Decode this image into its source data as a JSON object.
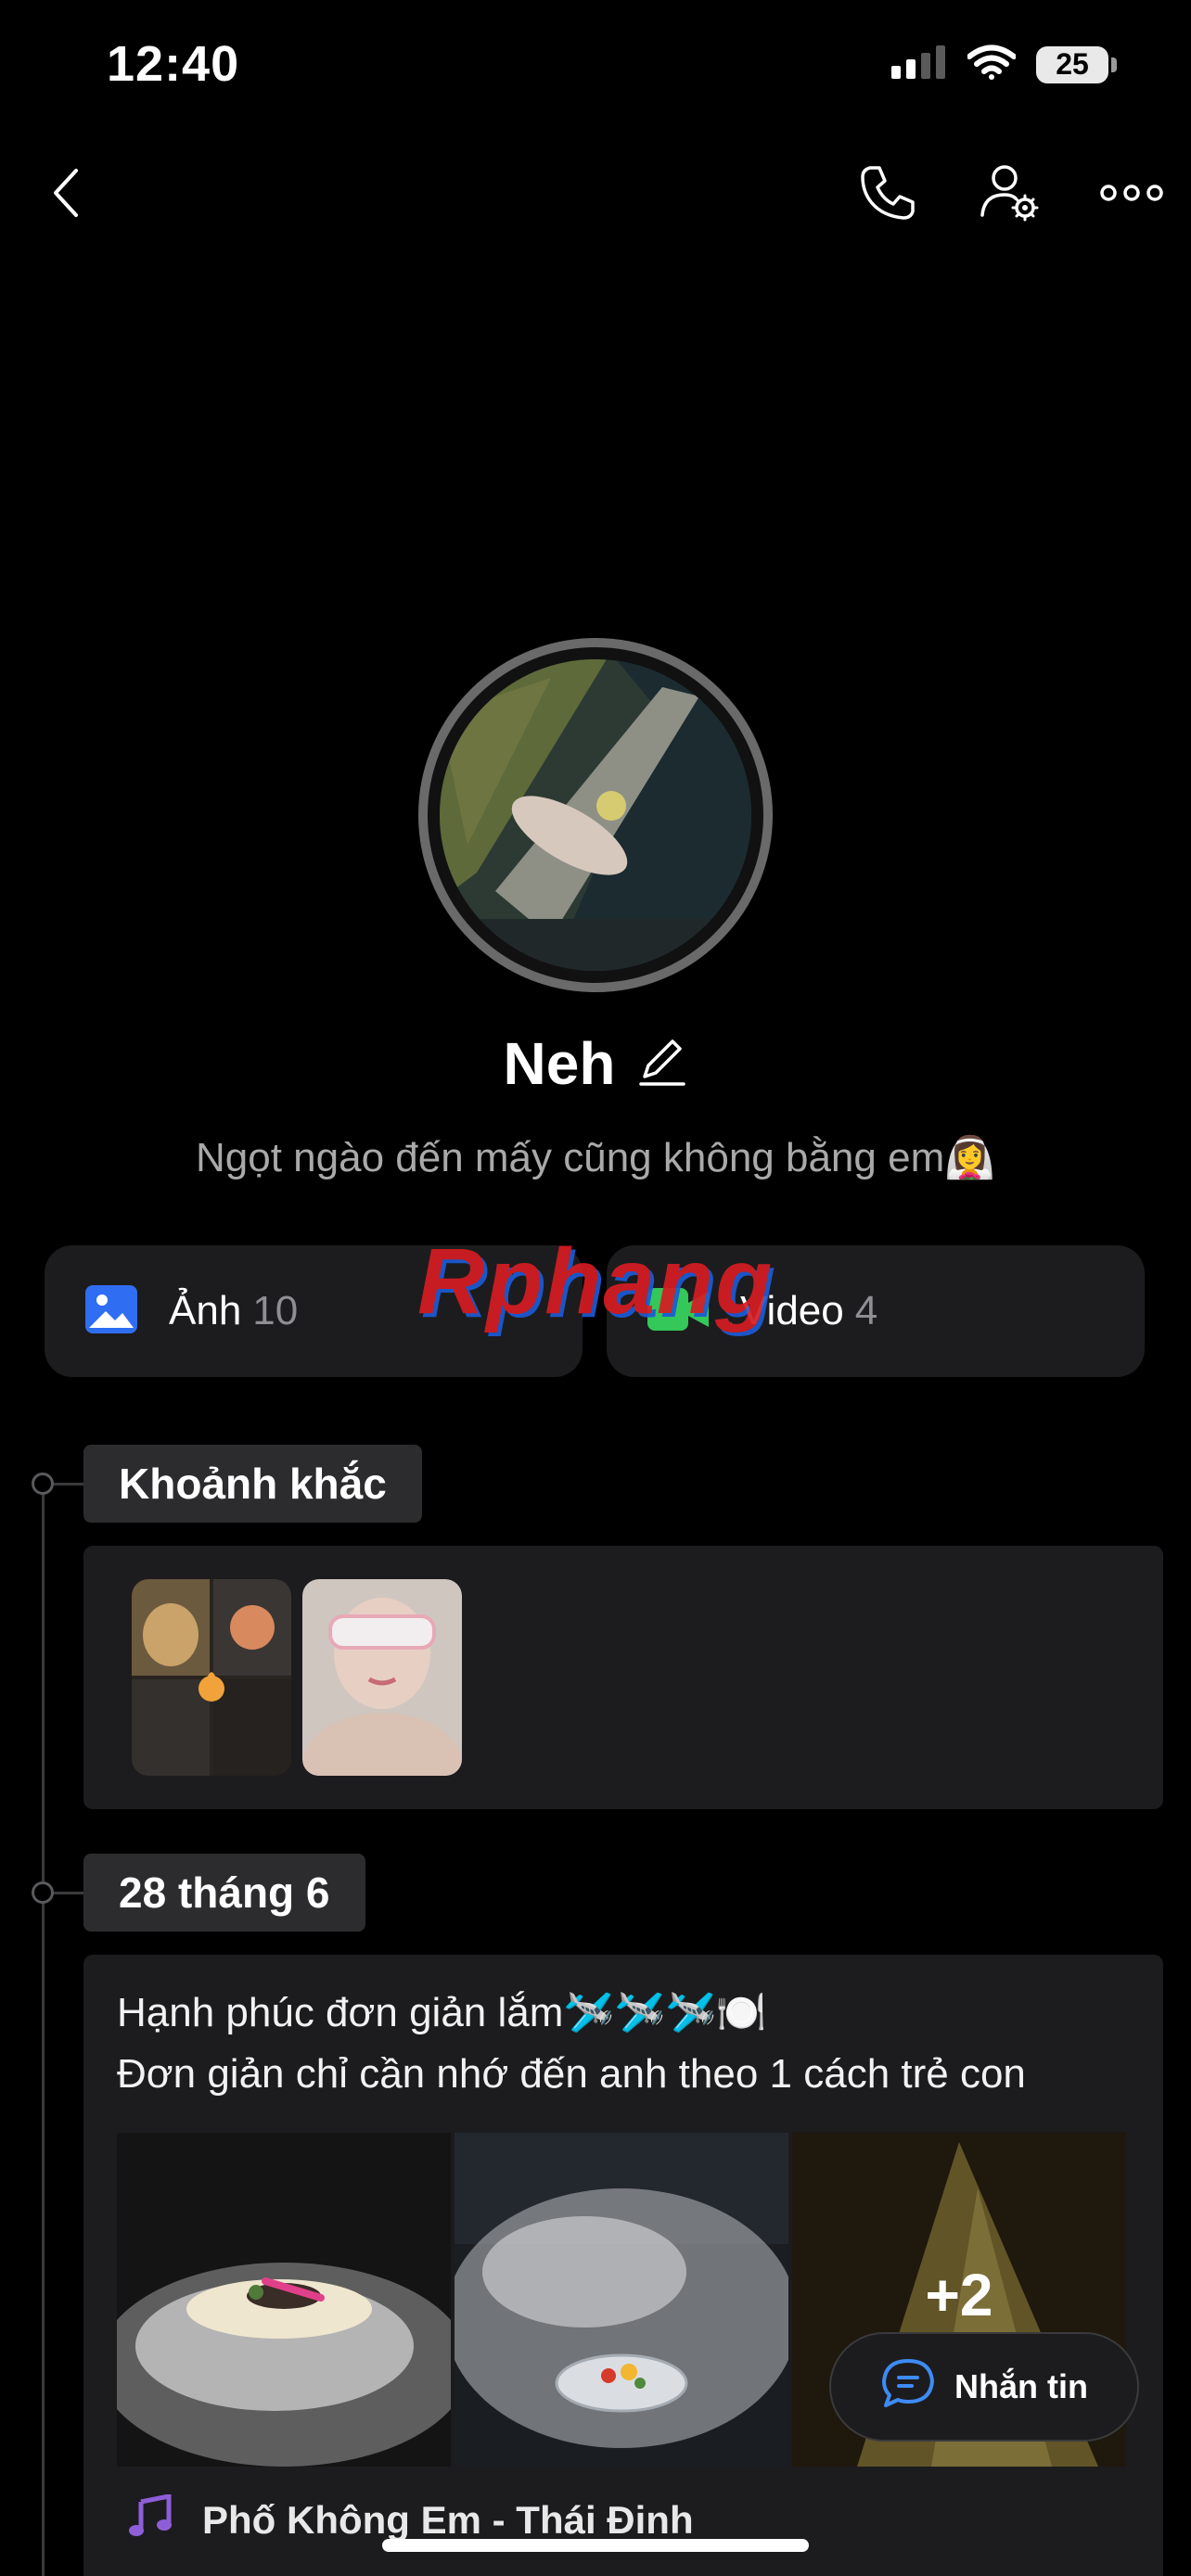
{
  "status_bar": {
    "time": "12:40",
    "battery": "25",
    "icons": [
      "signal-icon",
      "wifi-icon",
      "battery-icon"
    ]
  },
  "nav": {
    "icons": [
      "back-icon",
      "phone-icon",
      "user-settings-icon",
      "more-icon"
    ]
  },
  "profile": {
    "name": "Neh",
    "bio": "Ngọt ngào đến mấy cũng không bằng em👰‍♀️",
    "edit_icon": "pencil-icon"
  },
  "media": {
    "photos_label": "Ảnh",
    "photos_count": "10",
    "videos_label": "Video",
    "videos_count": "4"
  },
  "watermark": "Rphang",
  "timeline": {
    "moments_label": "Khoảnh khắc",
    "date_label": "28 tháng 6"
  },
  "post": {
    "line1": "Hạnh phúc đơn giản lắm🛩️🛩️🛩️🍽️",
    "line2": "Đơn giản chỉ cần nhớ đến anh theo 1 cách trẻ con",
    "more_count": "+2",
    "song": "Phố Không Em - Thái Đinh"
  },
  "message_button": {
    "label": "Nhắn tin"
  },
  "colors": {
    "background": "#000000",
    "card": "#1c1c1e",
    "chip": "#2c2c2e",
    "photo_icon": "#2f6ef3",
    "video_icon": "#34c759",
    "music_icon": "#8e5ed8"
  }
}
